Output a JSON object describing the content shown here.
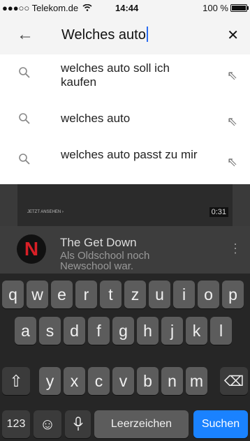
{
  "status_bar": {
    "carrier": "●●●○○ Telekom.de",
    "wifi": "wifi-icon",
    "time": "14:44",
    "battery": "100 %"
  },
  "search": {
    "query": "Welches auto",
    "back_icon": "arrow-left-icon",
    "clear_icon": "close-icon"
  },
  "suggestions": [
    {
      "text": "welches auto soll ich kaufen"
    },
    {
      "text": "welches auto"
    },
    {
      "text": "welches auto passt zu mir"
    }
  ],
  "background_video": {
    "label": "JETZT ANSEHEN ›",
    "duration": "0:31"
  },
  "channel": {
    "avatar_letter": "N",
    "title": "The Get Down",
    "description": "Als Oldschool noch Newschool war.",
    "more_icon": "⋮"
  },
  "keyboard": {
    "row1": [
      "q",
      "w",
      "e",
      "r",
      "t",
      "z",
      "u",
      "i",
      "o",
      "p"
    ],
    "row2": [
      "a",
      "s",
      "d",
      "f",
      "g",
      "h",
      "j",
      "k",
      "l"
    ],
    "row3": [
      "y",
      "x",
      "c",
      "v",
      "b",
      "n",
      "m"
    ],
    "shift": "⇧",
    "backspace": "⌫",
    "numbers": "123",
    "emoji": "☺",
    "mic": "🎤",
    "space": "Leerzeichen",
    "search": "Suchen"
  },
  "colors": {
    "accent": "#1a82ff",
    "netflix_red": "#d81f26"
  }
}
